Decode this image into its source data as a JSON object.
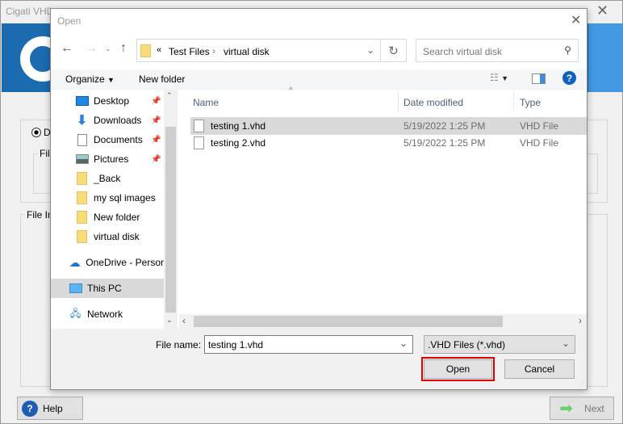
{
  "app": {
    "title": "Cigati VHD",
    "help_label": "Help",
    "next_label": "Next",
    "radio_label": "D",
    "group_file": "File",
    "group_file_info": "File In"
  },
  "dialog": {
    "title": "Open",
    "breadcrumb": {
      "prefix": "«",
      "items": [
        "Test Files",
        "virtual disk"
      ]
    },
    "search_placeholder": "Search virtual disk",
    "toolbar": {
      "organize": "Organize",
      "new_folder": "New folder"
    },
    "nav": [
      {
        "label": "Desktop",
        "icon": "desktop-icon",
        "pinned": true
      },
      {
        "label": "Downloads",
        "icon": "downloads-icon",
        "pinned": true
      },
      {
        "label": "Documents",
        "icon": "documents-icon",
        "pinned": true
      },
      {
        "label": "Pictures",
        "icon": "pictures-icon",
        "pinned": true
      },
      {
        "label": "_Back",
        "icon": "folder-icon",
        "pinned": false
      },
      {
        "label": "my sql images",
        "icon": "folder-icon",
        "pinned": false
      },
      {
        "label": "New folder",
        "icon": "folder-icon",
        "pinned": false
      },
      {
        "label": "virtual disk",
        "icon": "folder-icon",
        "pinned": false
      },
      {
        "label": "OneDrive - Persor",
        "icon": "onedrive-icon",
        "pinned": false
      },
      {
        "label": "This PC",
        "icon": "pc-icon",
        "pinned": false,
        "selected": true
      },
      {
        "label": "Network",
        "icon": "network-icon",
        "pinned": false
      }
    ],
    "columns": [
      "Name",
      "Date modified",
      "Type"
    ],
    "files": [
      {
        "name": "testing 1.vhd",
        "date": "5/19/2022 1:25 PM",
        "type": "VHD File",
        "selected": true
      },
      {
        "name": "testing 2.vhd",
        "date": "5/19/2022 1:25 PM",
        "type": "VHD File",
        "selected": false
      }
    ],
    "file_name_label": "File name:",
    "file_name_value": "testing 1.vhd",
    "file_type_value": ".VHD Files (*.vhd)",
    "open_label": "Open",
    "cancel_label": "Cancel",
    "highlight_color": "#e00000"
  }
}
